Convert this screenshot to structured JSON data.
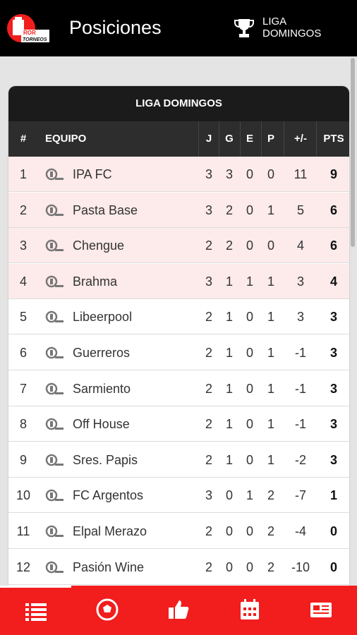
{
  "header": {
    "logo_text_line1": "ROR",
    "logo_text_line2": "TORNEOS",
    "title": "Posiciones",
    "league_line1": "LIGA",
    "league_line2": "DOMINGOS"
  },
  "table": {
    "title": "LIGA DOMINGOS",
    "columns": {
      "pos": "#",
      "team": "EQUIPO",
      "j": "J",
      "g": "G",
      "e": "E",
      "p": "P",
      "diff": "+/-",
      "pts": "PTS"
    },
    "rows": [
      {
        "pos": "1",
        "team": "IPA FC",
        "j": "3",
        "g": "3",
        "e": "0",
        "p": "0",
        "diff": "11",
        "pts": "9"
      },
      {
        "pos": "2",
        "team": "Pasta Base",
        "j": "3",
        "g": "2",
        "e": "0",
        "p": "1",
        "diff": "5",
        "pts": "6"
      },
      {
        "pos": "3",
        "team": "Chengue",
        "j": "2",
        "g": "2",
        "e": "0",
        "p": "0",
        "diff": "4",
        "pts": "6"
      },
      {
        "pos": "4",
        "team": "Brahma",
        "j": "3",
        "g": "1",
        "e": "1",
        "p": "1",
        "diff": "3",
        "pts": "4"
      },
      {
        "pos": "5",
        "team": "Libeerpool",
        "j": "2",
        "g": "1",
        "e": "0",
        "p": "1",
        "diff": "3",
        "pts": "3"
      },
      {
        "pos": "6",
        "team": "Guerreros",
        "j": "2",
        "g": "1",
        "e": "0",
        "p": "1",
        "diff": "-1",
        "pts": "3"
      },
      {
        "pos": "7",
        "team": "Sarmiento",
        "j": "2",
        "g": "1",
        "e": "0",
        "p": "1",
        "diff": "-1",
        "pts": "3"
      },
      {
        "pos": "8",
        "team": "Off House",
        "j": "2",
        "g": "1",
        "e": "0",
        "p": "1",
        "diff": "-1",
        "pts": "3"
      },
      {
        "pos": "9",
        "team": "Sres. Papis",
        "j": "2",
        "g": "1",
        "e": "0",
        "p": "1",
        "diff": "-2",
        "pts": "3"
      },
      {
        "pos": "10",
        "team": "FC Argentos",
        "j": "3",
        "g": "0",
        "e": "1",
        "p": "2",
        "diff": "-7",
        "pts": "1"
      },
      {
        "pos": "11",
        "team": "Elpal Merazo",
        "j": "2",
        "g": "0",
        "e": "0",
        "p": "2",
        "diff": "-4",
        "pts": "0"
      },
      {
        "pos": "12",
        "team": "Pasión Wine",
        "j": "2",
        "g": "0",
        "e": "0",
        "p": "2",
        "diff": "-10",
        "pts": "0"
      }
    ]
  },
  "nav": {
    "items": [
      {
        "icon": "standings-list-icon",
        "active": true
      },
      {
        "icon": "soccer-ball-icon",
        "active": false
      },
      {
        "icon": "thumbs-up-icon",
        "active": false
      },
      {
        "icon": "calendar-icon",
        "active": false
      },
      {
        "icon": "news-icon",
        "active": false
      }
    ]
  },
  "colors": {
    "accent": "#f21d1d",
    "header_bg": "#000000",
    "highlight_row": "#fdeaea"
  }
}
